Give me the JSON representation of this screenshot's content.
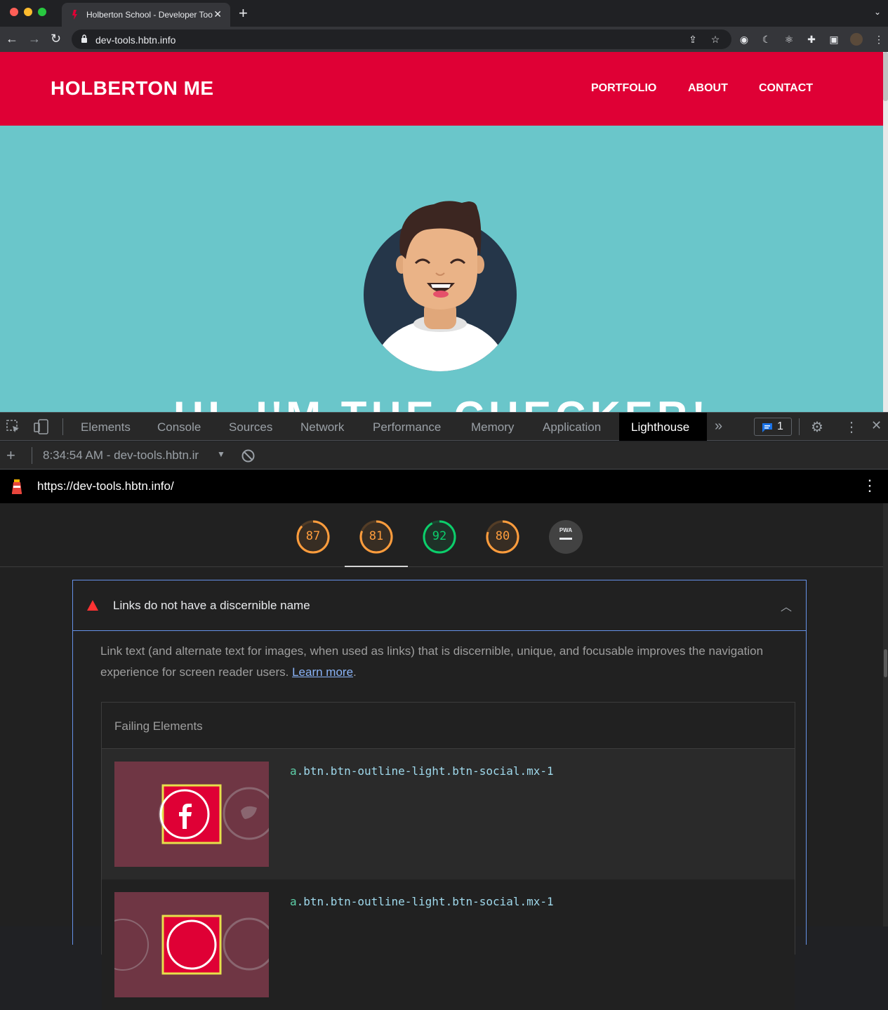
{
  "browser": {
    "tab_title": "Holberton School - Developer Tools",
    "url": "dev-tools.hbtn.info"
  },
  "site": {
    "brand": "HOLBERTON ME",
    "nav": [
      "PORTFOLIO",
      "ABOUT",
      "CONTACT"
    ],
    "hero_heading": "HI, I'M THE CHECKER!"
  },
  "devtools": {
    "tabs": [
      "Elements",
      "Console",
      "Sources",
      "Network",
      "Performance",
      "Memory",
      "Application",
      "Lighthouse"
    ],
    "active_tab": "Lighthouse",
    "issues_count": "1",
    "report_label": "8:34:54 AM - dev-tools.hbtn.ir",
    "lighthouse_url": "https://dev-tools.hbtn.info/"
  },
  "lighthouse": {
    "scores": [
      {
        "value": 87,
        "label": "87",
        "color": "#ff9d3d"
      },
      {
        "value": 81,
        "label": "81",
        "color": "#ff9d3d"
      },
      {
        "value": 92,
        "label": "92",
        "color": "#0cce6b"
      },
      {
        "value": 80,
        "label": "80",
        "color": "#ff9d3d"
      }
    ],
    "pwa_label": "PWA",
    "audit": {
      "title": "Links do not have a discernible name",
      "description": "Link text (and alternate text for images, when used as links) that is discernible, unique, and focusable improves the navigation experience for screen reader users.",
      "learn_more": "Learn more",
      "period": ".",
      "failing_header": "Failing Elements",
      "rows": [
        {
          "tag": "a",
          "classes": ".btn.btn-outline-light.btn-social.mx-1"
        },
        {
          "tag": "a",
          "classes": ".btn.btn-outline-light.btn-social.mx-1"
        }
      ]
    }
  },
  "colors": {
    "header_red": "#df0035",
    "hero_teal": "#6ac6ca",
    "audit_fail": "#ff3333"
  }
}
